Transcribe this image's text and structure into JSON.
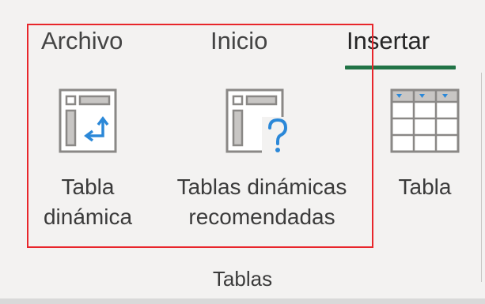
{
  "ribbon": {
    "tabs": [
      {
        "label": "Archivo"
      },
      {
        "label": "Inicio"
      },
      {
        "label": "Insertar",
        "active": true
      }
    ],
    "accent_color": "#217346",
    "highlight_color": "#e8262b",
    "group": {
      "name": "Tablas",
      "commands": [
        {
          "id": "pivot",
          "icon": "pivot-table-icon",
          "lines": [
            "Tabla",
            "dinámica"
          ]
        },
        {
          "id": "recommended",
          "icon": "recommended-pivot-tables-icon",
          "lines": [
            "Tablas dinámicas",
            "recomendadas"
          ]
        },
        {
          "id": "table",
          "icon": "table-icon",
          "lines": [
            "Tabla"
          ]
        }
      ]
    }
  }
}
